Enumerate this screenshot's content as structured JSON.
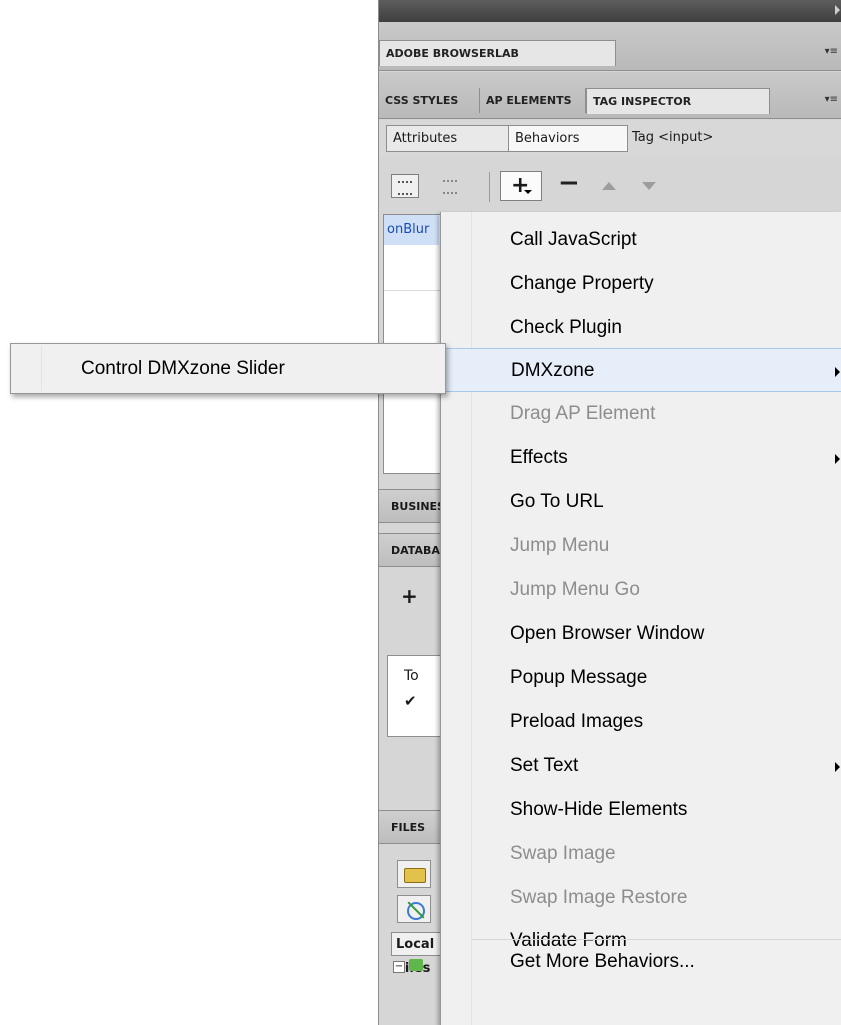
{
  "panel": {
    "top_tabs": [
      "ADOBE BROWSERLAB"
    ],
    "second_tabs": [
      "CSS STYLES",
      "AP ELEMENTS",
      "TAG INSPECTOR"
    ],
    "subtabs": [
      "Attributes",
      "Behaviors"
    ],
    "tag_label": "Tag <input>",
    "toolbar": {
      "add": "+",
      "remove": "−"
    },
    "event_cell": "onBlur",
    "collapsed_panels": [
      "BUSINESS CATALYST",
      "DATABASES",
      "FILES"
    ],
    "db_plus": "+",
    "db_text": "To",
    "db_check": "✔",
    "local_header": "Local Files"
  },
  "menu": {
    "items": [
      {
        "label": "Call JavaScript",
        "enabled": true,
        "submenu": false
      },
      {
        "label": "Change Property",
        "enabled": true,
        "submenu": false
      },
      {
        "label": "Check Plugin",
        "enabled": true,
        "submenu": false
      },
      {
        "label": "DMXzone",
        "enabled": true,
        "submenu": true,
        "highlighted": true
      },
      {
        "label": "Drag AP Element",
        "enabled": false,
        "submenu": false
      },
      {
        "label": "Effects",
        "enabled": true,
        "submenu": true
      },
      {
        "label": "Go To URL",
        "enabled": true,
        "submenu": false
      },
      {
        "label": "Jump Menu",
        "enabled": false,
        "submenu": false
      },
      {
        "label": "Jump Menu Go",
        "enabled": false,
        "submenu": false
      },
      {
        "label": "Open Browser Window",
        "enabled": true,
        "submenu": false
      },
      {
        "label": "Popup Message",
        "enabled": true,
        "submenu": false
      },
      {
        "label": "Preload Images",
        "enabled": true,
        "submenu": false
      },
      {
        "label": "Set Text",
        "enabled": true,
        "submenu": true
      },
      {
        "label": "Show-Hide Elements",
        "enabled": true,
        "submenu": false
      },
      {
        "label": "Swap Image",
        "enabled": false,
        "submenu": false
      },
      {
        "label": "Swap Image Restore",
        "enabled": false,
        "submenu": false
      },
      {
        "label": "Validate Form",
        "enabled": true,
        "submenu": false
      }
    ],
    "footer_item": "Get More Behaviors..."
  },
  "submenu": {
    "items": [
      "Control DMXzone Slider"
    ]
  },
  "colors": {
    "menu_bg": "#f0f0f0",
    "highlight_bg": "#e6eef9",
    "highlight_border": "#a8c8ec",
    "disabled_text": "#8d8d8d",
    "event_text": "#1a4bb5"
  }
}
